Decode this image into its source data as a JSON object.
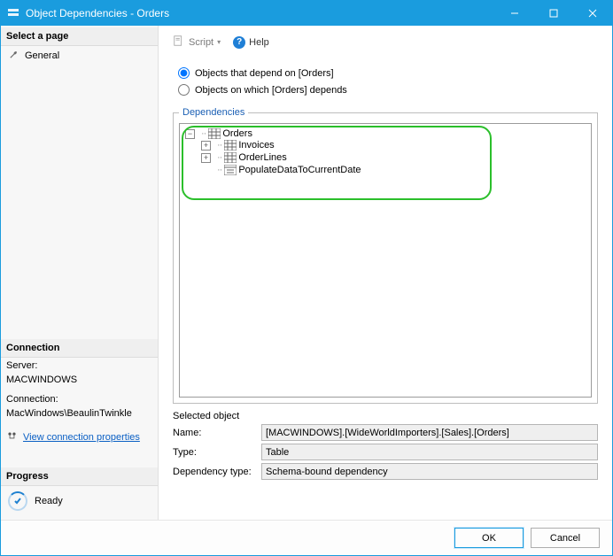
{
  "window": {
    "title": "Object Dependencies - Orders"
  },
  "sidebar": {
    "select_page": "Select a page",
    "general": "General",
    "connection_hdr": "Connection",
    "server_label": "Server:",
    "server_value": "MACWINDOWS",
    "connection_label": "Connection:",
    "connection_value": "MacWindows\\BeaulinTwinkle",
    "view_conn_props": "View connection properties",
    "progress_hdr": "Progress",
    "progress_status": "Ready"
  },
  "toolbar": {
    "script": "Script",
    "help": "Help"
  },
  "radios": {
    "depend_on": "Objects that depend on [Orders]",
    "depends": "Objects on which [Orders] depends"
  },
  "dependencies": {
    "legend": "Dependencies",
    "tree": {
      "root": "Orders",
      "children": [
        {
          "label": "Invoices",
          "expandable": true
        },
        {
          "label": "OrderLines",
          "expandable": true
        },
        {
          "label": "PopulateDataToCurrentDate",
          "expandable": false
        }
      ]
    }
  },
  "details": {
    "selected_object": "Selected object",
    "name_label": "Name:",
    "name_value": "[MACWINDOWS].[WideWorldImporters].[Sales].[Orders]",
    "type_label": "Type:",
    "type_value": "Table",
    "deptype_label": "Dependency type:",
    "deptype_value": "Schema-bound dependency"
  },
  "footer": {
    "ok": "OK",
    "cancel": "Cancel"
  }
}
